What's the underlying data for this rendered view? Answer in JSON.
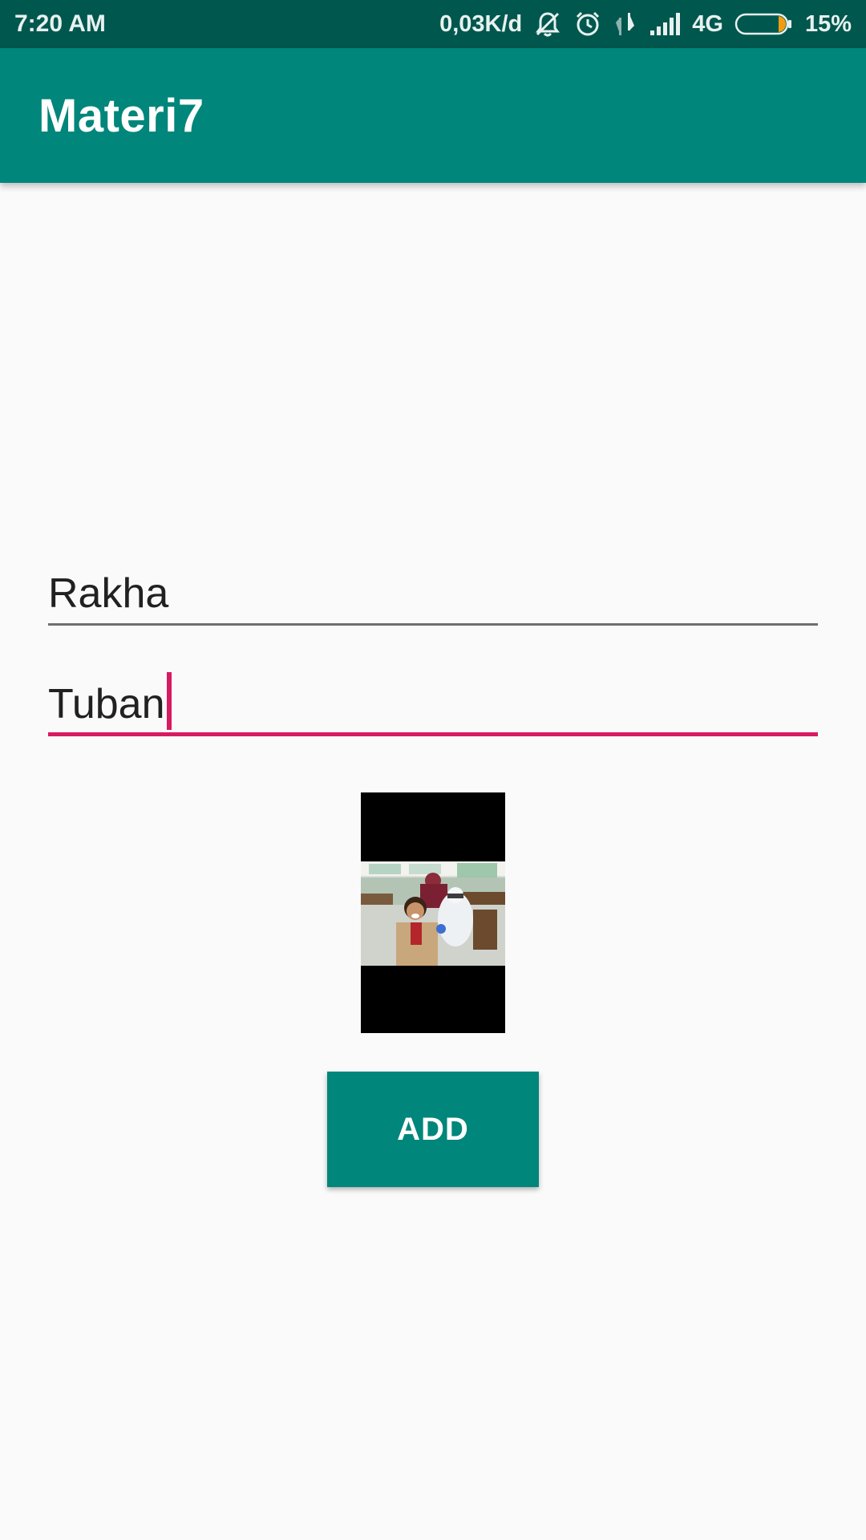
{
  "status_bar": {
    "time": "7:20 AM",
    "data_speed": "0,03K/d",
    "network_type": "4G",
    "battery_percent": "15%",
    "battery_level": 0.15,
    "icons": [
      "muted-bell-icon",
      "alarm-icon",
      "data-transfer-icon",
      "signal-icon",
      "battery-icon"
    ]
  },
  "app_bar": {
    "title": "Materi7"
  },
  "form": {
    "name_value": "Rakha",
    "city_value": "Tuban",
    "add_label": "ADD"
  },
  "colors": {
    "status_bar": "#00574e",
    "primary": "#00867a",
    "accent": "#d81b60",
    "background": "#fafafa",
    "battery_fill": "#f39c12"
  }
}
